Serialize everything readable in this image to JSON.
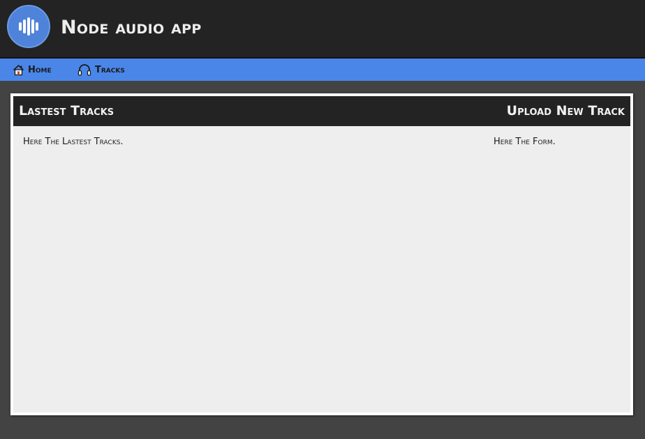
{
  "app": {
    "title": "Node audio app",
    "logo_icon": "audio-wave-icon",
    "accent": "#4a86e8",
    "header_bg": "#232323",
    "page_bg": "#434343"
  },
  "nav": {
    "items": [
      {
        "label": "Home",
        "icon": "home-icon"
      },
      {
        "label": "Tracks",
        "icon": "headphones-icon"
      }
    ]
  },
  "main": {
    "latest": {
      "title": "Lastest Tracks",
      "text": "Here The Lastest Tracks."
    },
    "upload": {
      "title": "Upload New Track",
      "text": "Here The Form."
    }
  }
}
